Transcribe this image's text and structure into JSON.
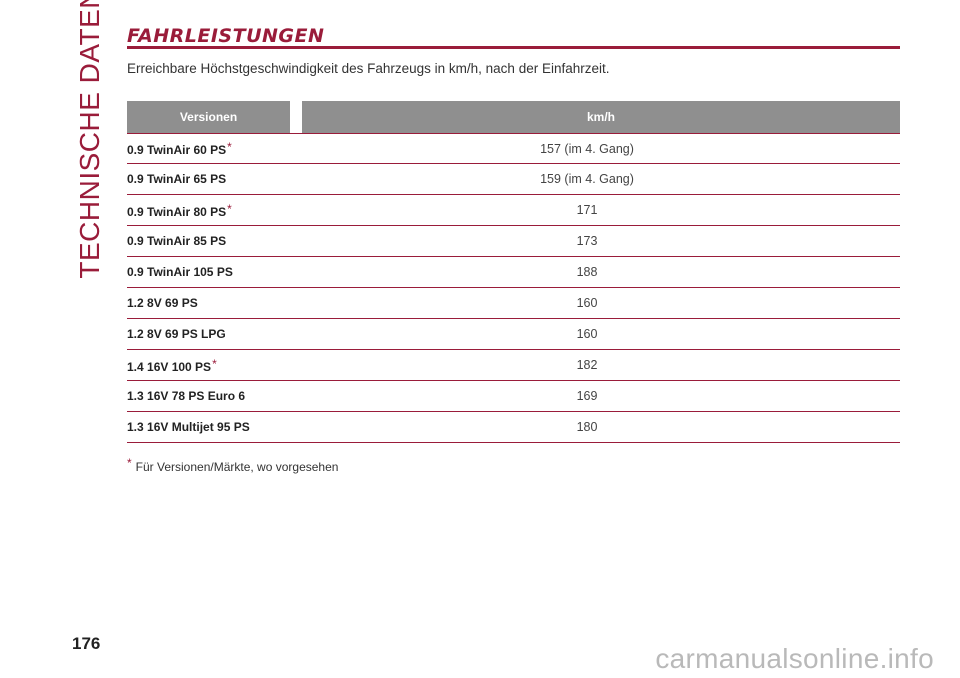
{
  "side_title": "TECHNISCHE DATEN",
  "heading": "FAHRLEISTUNGEN",
  "intro": "Erreichbare Höchstgeschwindigkeit des Fahrzeugs in km/h, nach der Einfahrzeit.",
  "table": {
    "headers": [
      "Versionen",
      "km/h"
    ],
    "rows": [
      {
        "version": "0.9 TwinAir 60 PS",
        "star": "*",
        "speed": "157 (im 4. Gang)"
      },
      {
        "version": "0.9 TwinAir 65 PS",
        "star": "",
        "speed": "159 (im 4. Gang)"
      },
      {
        "version": "0.9 TwinAir 80 PS",
        "star": "*",
        "speed": "171"
      },
      {
        "version": "0.9 TwinAir 85 PS",
        "star": "",
        "speed": "173"
      },
      {
        "version": "0.9 TwinAir 105 PS",
        "star": "",
        "speed": "188"
      },
      {
        "version": "1.2 8V 69 PS",
        "star": "",
        "speed": "160"
      },
      {
        "version": "1.2 8V 69 PS LPG",
        "star": "",
        "speed": "160"
      },
      {
        "version": "1.4 16V 100 PS",
        "star": "*",
        "speed": "182"
      },
      {
        "version": "1.3 16V 78 PS Euro 6",
        "star": "",
        "speed": "169"
      },
      {
        "version": "1.3 16V Multijet 95 PS",
        "star": "",
        "speed": "180"
      }
    ]
  },
  "footnote": {
    "star": "*",
    "text": "Für Versionen/Märkte, wo vorgesehen"
  },
  "page_number": "176",
  "watermark": "carmanualsonline.info",
  "colors": {
    "accent": "#9a1c3a",
    "header_bg": "#8f8f8f"
  }
}
